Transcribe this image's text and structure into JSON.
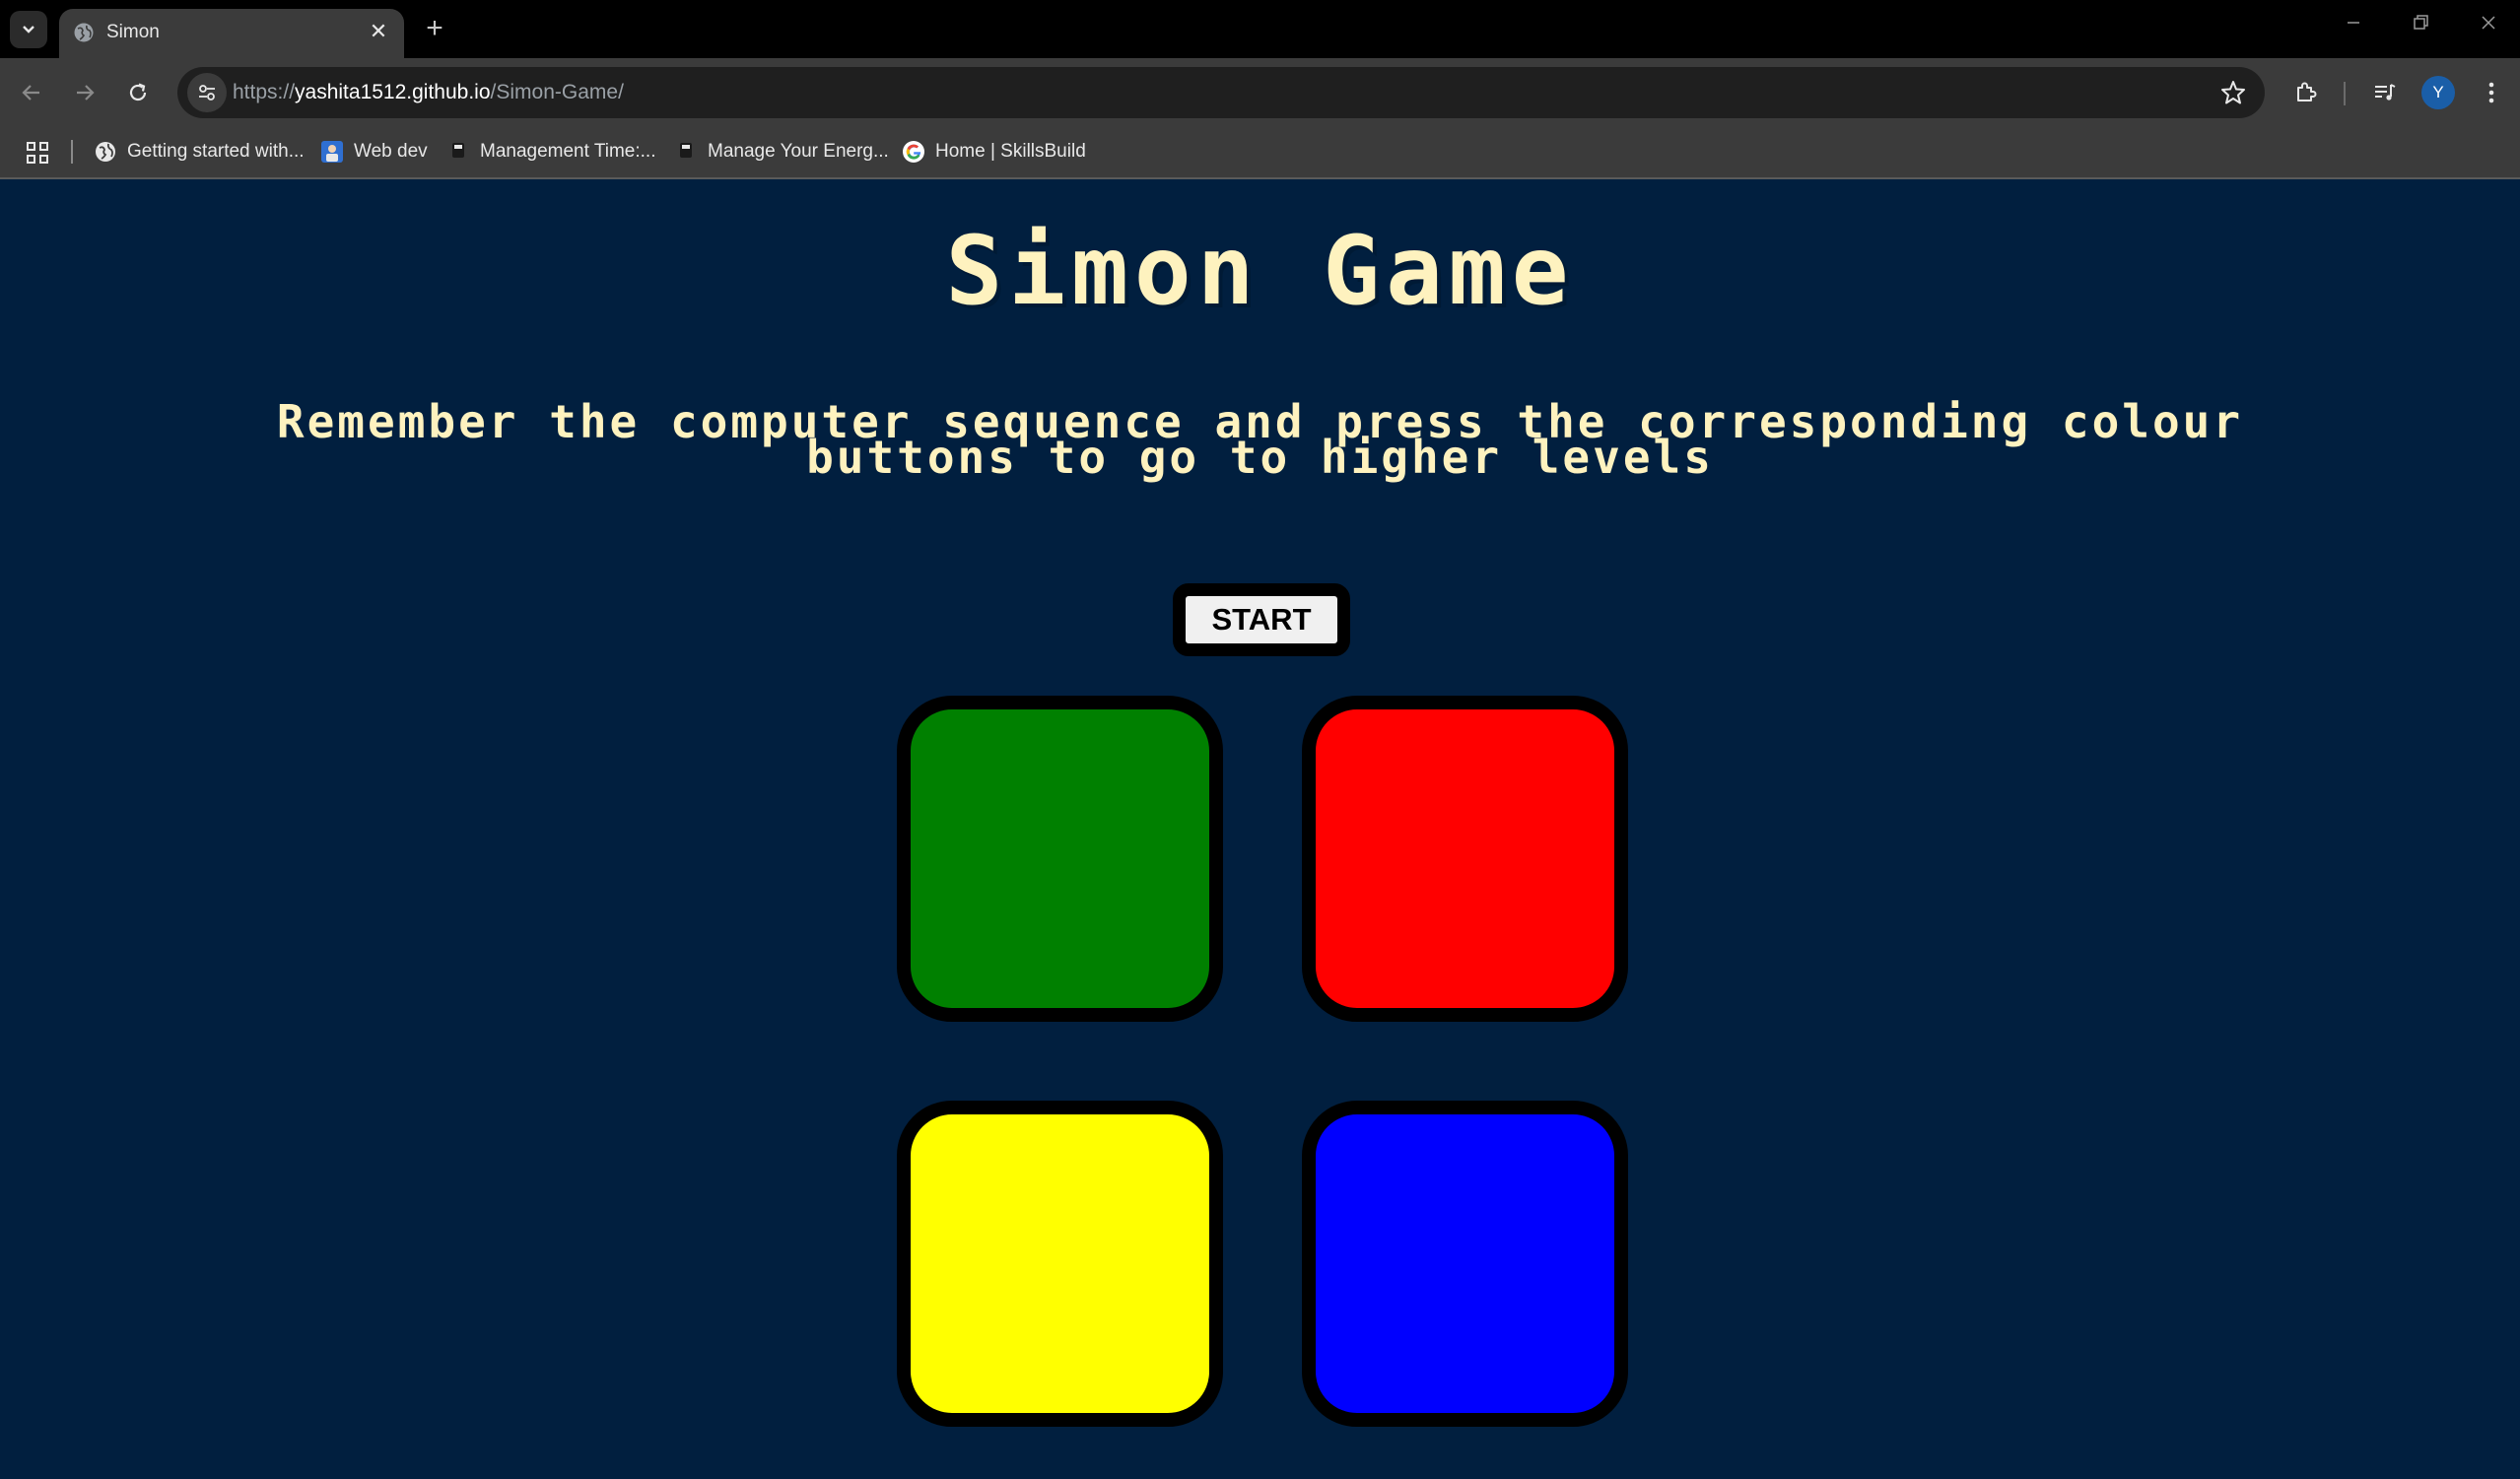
{
  "browser": {
    "tab_title": "Simon",
    "tab_close": "✕",
    "new_tab": "+",
    "url_scheme": "https://",
    "url_host": "yashita1512.github.io",
    "url_path": "/Simon-Game/",
    "profile_initial": "Y",
    "bookmarks": [
      {
        "label": "Getting started with...",
        "icon": "globe-icon"
      },
      {
        "label": "Web dev",
        "icon": "web-dev-favicon"
      },
      {
        "label": "Management Time:...",
        "icon": "page-icon"
      },
      {
        "label": "Manage Your Energ...",
        "icon": "page-icon"
      },
      {
        "label": "Home | SkillsBuild",
        "icon": "google-g-icon"
      }
    ]
  },
  "game": {
    "title": "Simon Game",
    "instructions": "Remember the computer sequence and press the corresponding colour buttons to go to higher levels",
    "start_label": "START",
    "pads": [
      {
        "name": "green",
        "color": "#008000"
      },
      {
        "name": "red",
        "color": "#FF0000"
      },
      {
        "name": "yellow",
        "color": "#FFFF00"
      },
      {
        "name": "blue",
        "color": "#0000FF"
      }
    ]
  },
  "colors": {
    "background": "#011F3F",
    "text": "#FEF2BF"
  }
}
